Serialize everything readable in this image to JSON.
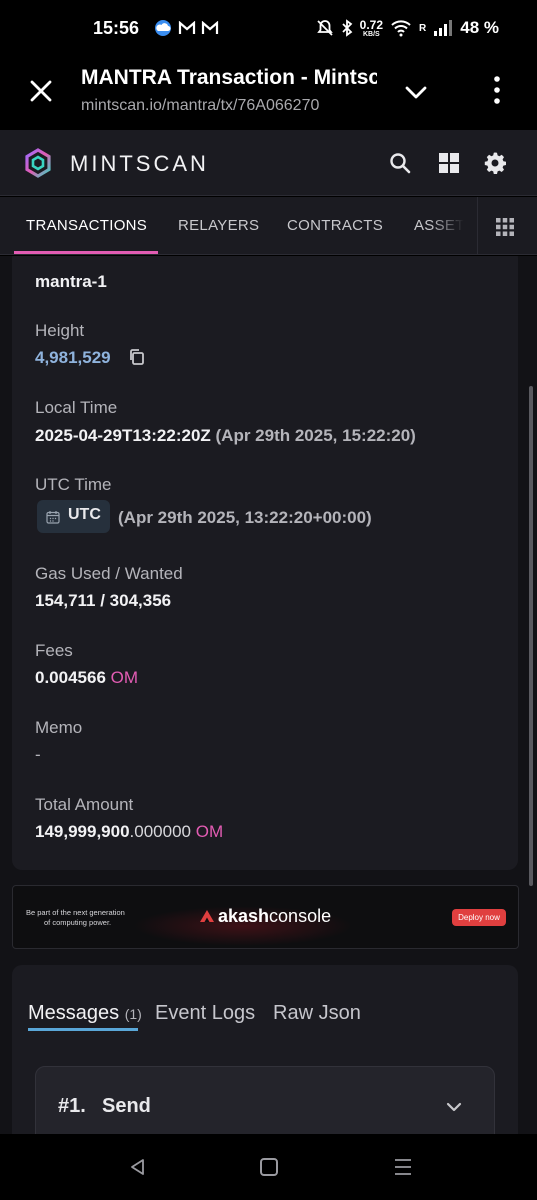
{
  "status_bar": {
    "time": "15:56",
    "net_speed": "0.72",
    "net_unit": "KB/S",
    "signal_label": "R",
    "battery": "48 %",
    "icons": [
      "cloud-icon",
      "gmail-icon",
      "gmail-icon",
      "mute-icon",
      "bluetooth-icon",
      "wifi-icon",
      "signal-icon"
    ]
  },
  "browser": {
    "title": "MANTRA Transaction - Mintscan",
    "url": "mintscan.io/mantra/tx/76A066270"
  },
  "site": {
    "brand": "MINTSCAN",
    "accent": "#e25cb3"
  },
  "nav": {
    "tabs": [
      "TRANSACTIONS",
      "RELAYERS",
      "CONTRACTS",
      "ASSETS"
    ],
    "active": "TRANSACTIONS"
  },
  "tx": {
    "chain_id": "mantra-1",
    "height_label": "Height",
    "height": "4,981,529",
    "local_time_label": "Local Time",
    "local_time": "2025-04-29T13:22:20Z",
    "local_time_human": "(Apr 29th 2025, 15:22:20)",
    "utc_time_label": "UTC Time",
    "utc_badge": "UTC",
    "utc_time_human": "(Apr 29th 2025, 13:22:20+00:00)",
    "gas_label": "Gas Used / Wanted",
    "gas": "154,711 / 304,356",
    "fees_label": "Fees",
    "fees_amount": "0.004566",
    "fees_denom": "OM",
    "memo_label": "Memo",
    "memo": "-",
    "total_label": "Total Amount",
    "total_int": "149,999,900",
    "total_dec": ".000000",
    "total_denom": "OM"
  },
  "ad": {
    "tagline_1": "Be part of the next generation",
    "tagline_2": "of computing power.",
    "brand_bold": "akash",
    "brand_light": "console",
    "cta": "Deploy now"
  },
  "messages": {
    "tabs": [
      "Messages",
      "Event Logs",
      "Raw Json"
    ],
    "count": "(1)",
    "items": [
      {
        "index": "#1.",
        "type": "Send"
      }
    ]
  }
}
